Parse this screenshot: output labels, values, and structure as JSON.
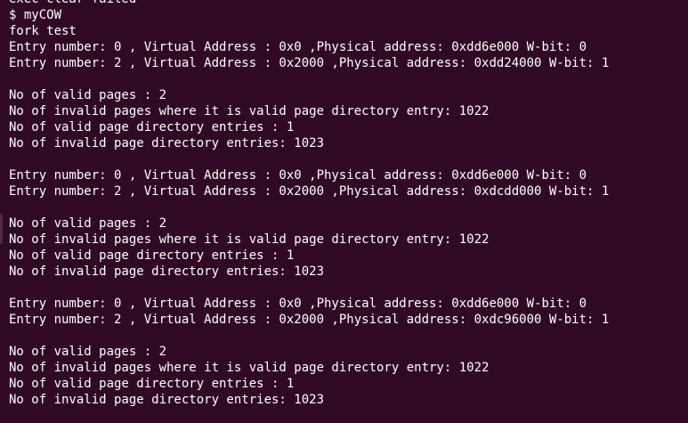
{
  "terminal": {
    "lines": [
      "exec clear failed",
      "$ myCOW",
      "fork test",
      "Entry number: 0 , Virtual Address : 0x0 ,Physical address: 0xdd6e000 W-bit: 0",
      "Entry number: 2 , Virtual Address : 0x2000 ,Physical address: 0xdd24000 W-bit: 1",
      "",
      "No of valid pages : 2",
      "No of invalid pages where it is valid page directory entry: 1022",
      "No of valid page directory entries : 1",
      "No of invalid page directory entries: 1023",
      "",
      "Entry number: 0 , Virtual Address : 0x0 ,Physical address: 0xdd6e000 W-bit: 0",
      "Entry number: 2 , Virtual Address : 0x2000 ,Physical address: 0xdcdd000 W-bit: 1",
      "",
      "No of valid pages : 2",
      "No of invalid pages where it is valid page directory entry: 1022",
      "No of valid page directory entries : 1",
      "No of invalid page directory entries: 1023",
      "",
      "Entry number: 0 , Virtual Address : 0x0 ,Physical address: 0xdd6e000 W-bit: 0",
      "Entry number: 2 , Virtual Address : 0x2000 ,Physical address: 0xdc96000 W-bit: 1",
      "",
      "No of valid pages : 2",
      "No of invalid pages where it is valid page directory entry: 1022",
      "No of valid page directory entries : 1",
      "No of invalid page directory entries: 1023"
    ]
  },
  "colors": {
    "background": "#300a24",
    "text": "#ffffff"
  }
}
